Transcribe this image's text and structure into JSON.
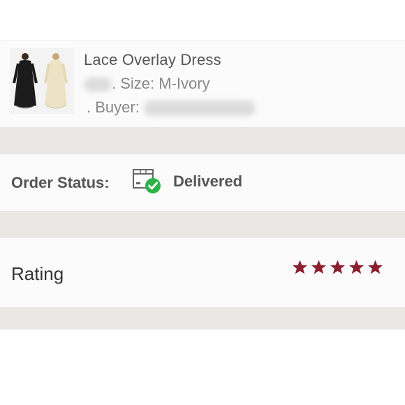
{
  "item": {
    "title": "Lace Overlay Dress",
    "size_label": ". Size: M-Ivory",
    "buyer_label": ". Buyer:",
    "thumbnail_icon": "dress-photo-icon"
  },
  "order": {
    "status_label": "Order Status:",
    "status_value": "Delivered",
    "status_icon": "delivered-box-icon",
    "check_color": "#2bb34a"
  },
  "rating": {
    "label": "Rating",
    "stars": 5,
    "max_stars": 5,
    "star_color": "#8b1f2f"
  },
  "colors": {
    "separator": "#e9e8e5"
  }
}
